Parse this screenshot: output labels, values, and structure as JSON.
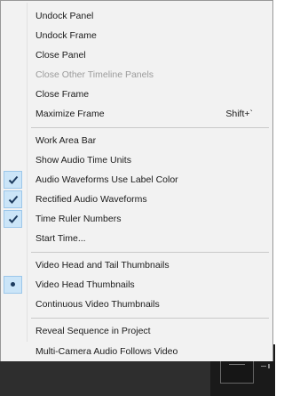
{
  "menu": {
    "items": [
      {
        "label": "Undock Panel"
      },
      {
        "label": "Undock Frame"
      },
      {
        "label": "Close Panel"
      },
      {
        "label": "Close Other Timeline Panels"
      },
      {
        "label": "Close Frame"
      },
      {
        "label": "Maximize Frame",
        "shortcut": "Shift+`"
      },
      {
        "label": "Work Area Bar"
      },
      {
        "label": "Show Audio Time Units"
      },
      {
        "label": "Audio Waveforms Use Label Color"
      },
      {
        "label": "Rectified Audio Waveforms"
      },
      {
        "label": "Time Ruler Numbers"
      },
      {
        "label": "Start Time..."
      },
      {
        "label": "Video Head and Tail Thumbnails"
      },
      {
        "label": "Video Head Thumbnails"
      },
      {
        "label": "Continuous Video Thumbnails"
      },
      {
        "label": "Reveal Sequence in Project"
      },
      {
        "label": "Multi-Camera Audio Follows Video"
      }
    ]
  },
  "checked_items": [
    "Audio Waveforms Use Label Color",
    "Rectified Audio Waveforms",
    "Time Ruler Numbers"
  ],
  "selected_radio": "Video Head Thumbnails",
  "disabled_items": [
    "Close Other Timeline Panels"
  ],
  "colors": {
    "menu_bg": "#f2f2f2",
    "check_bg": "#cbe5f8",
    "disabled_text": "#9b9b9b",
    "dark_panel": "#2e2e2e"
  },
  "icons": {
    "check": "check-icon",
    "radio": "bullet-icon",
    "grip": "grip-icon"
  }
}
